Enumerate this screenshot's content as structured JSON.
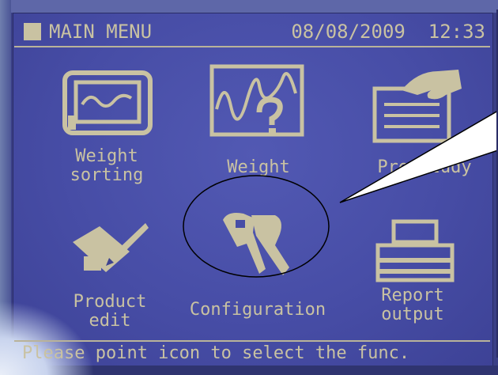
{
  "header": {
    "title": "MAIN MENU",
    "date": "08/08/2009",
    "time": "12:33"
  },
  "menu": {
    "items": [
      {
        "icon": "monitor-wave-icon",
        "label_line1": "Weight",
        "label_line2": "sorting"
      },
      {
        "icon": "chart-question-icon",
        "label_line1": "Weight",
        "label_line2": ""
      },
      {
        "icon": "hand-document-icon",
        "label_line1": "Pre Study",
        "label_line2": ""
      },
      {
        "icon": "pen-edit-icon",
        "label_line1": "Product",
        "label_line2": "edit"
      },
      {
        "icon": "keys-icon",
        "label_line1": "Configuration",
        "label_line2": ""
      },
      {
        "icon": "printer-icon",
        "label_line1": "Report",
        "label_line2": "output"
      }
    ]
  },
  "status": {
    "text": "Please point icon to select the func."
  },
  "colors": {
    "lcd_text": "#c9c2a2",
    "screen_bg": "#474da6"
  }
}
